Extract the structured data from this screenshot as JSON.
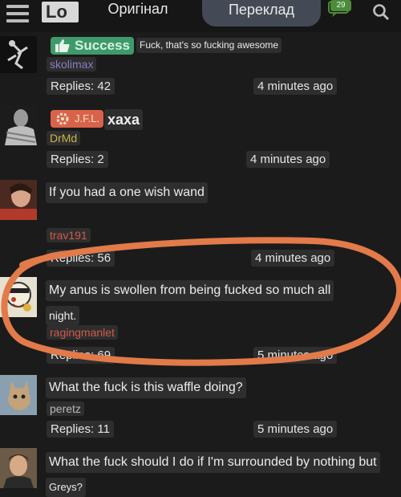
{
  "header": {
    "logo_text": "Lo",
    "tab_original": "Оригінал",
    "tab_translation": "Переклад",
    "chat_count": "29"
  },
  "posts": [
    {
      "badge": "Success",
      "text": "Fuck, that's so fucking awesome",
      "user": "skolimax",
      "replies": "Replies: 42",
      "time": "4 minutes ago"
    },
    {
      "badge": "J.F.L.",
      "text": "хаха",
      "user": "DrMd",
      "replies": "Replies: 2",
      "time": "4 minutes ago"
    },
    {
      "text": "If you had a one wish wand",
      "user": "trav191",
      "replies": "Replies: 56",
      "time": "4 minutes ago"
    },
    {
      "text_line1": "My anus is swollen from being fucked so much all",
      "text_line2": "night.",
      "user": "ragingmanlet",
      "replies": "Replies: 69",
      "time": "5 minutes ago"
    },
    {
      "text": "What the fuck is this waffle doing?",
      "user": "peretz",
      "replies": "Replies: 11",
      "time": "5 minutes ago"
    },
    {
      "text_line1": "What the fuck should I do if I'm surrounded by nothing but",
      "text_line2": "Greys?"
    }
  ],
  "colors": {
    "background": "#1b1b1b",
    "chip": "#2e2e2e",
    "success_badge": "#3f9a6a",
    "jfl_badge": "#d9634a",
    "user_purple": "#8a7cc4",
    "user_yellow": "#c9b44a",
    "user_red": "#d05a4a",
    "user_grey": "#b8b8b8",
    "annotation_orange": "#e27a4a"
  }
}
